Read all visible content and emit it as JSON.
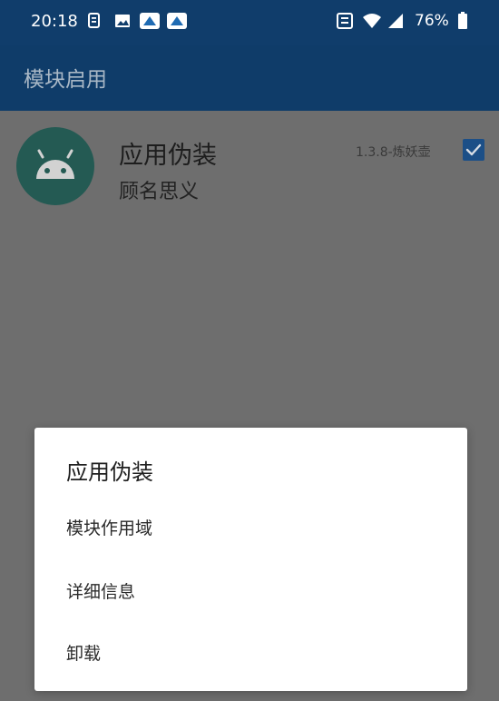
{
  "status_bar": {
    "time": "20:18",
    "battery": "76%",
    "icons": [
      "file-icon",
      "image-icon",
      "app-icon",
      "app-icon",
      "notification-icon",
      "wifi-icon",
      "signal-icon",
      "battery-icon"
    ]
  },
  "app_bar": {
    "title": "模块启用"
  },
  "module": {
    "name": "应用伪装",
    "description": "顾名思义",
    "version": "1.3.8-炼妖壶",
    "enabled": true,
    "icon": "android-icon"
  },
  "dialog": {
    "title": "应用伪装",
    "items": [
      {
        "label": "模块作用域"
      },
      {
        "label": "详细信息"
      },
      {
        "label": "卸载"
      }
    ]
  },
  "colors": {
    "app_bar": "#0f3c69",
    "scrim": "#6e6e6e",
    "checkbox": "#1c4f87",
    "avatar": "#245a53"
  }
}
